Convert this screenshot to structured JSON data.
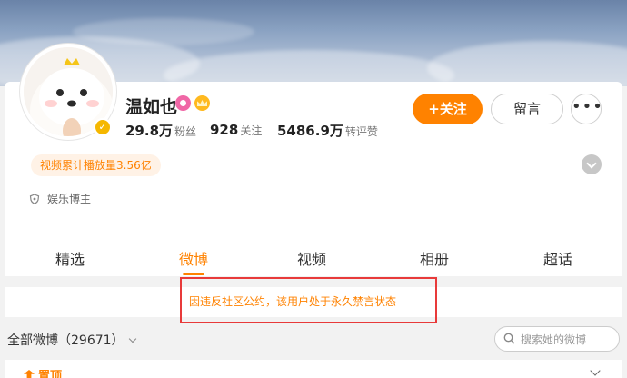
{
  "profile": {
    "name": "温如也",
    "stats": [
      {
        "value": "29.8万",
        "label": "粉丝"
      },
      {
        "value": "928",
        "label": "关注"
      },
      {
        "value": "5486.9万",
        "label": "转评赞"
      }
    ],
    "views_tag": "视频累计播放量3.56亿",
    "category": "娱乐博主"
  },
  "actions": {
    "follow_label": "+关注",
    "message_label": "留言",
    "more_label": "•••"
  },
  "tabs": [
    {
      "label": "精选",
      "active": false
    },
    {
      "label": "微博",
      "active": true
    },
    {
      "label": "视频",
      "active": false
    },
    {
      "label": "相册",
      "active": false
    },
    {
      "label": "超话",
      "active": false
    }
  ],
  "notice": "因违反社区公约，该用户处于永久禁言状态",
  "posts": {
    "all_label": "全部微博（29671）",
    "search_placeholder": "搜索她的微博",
    "pinned_label": "置顶"
  },
  "colors": {
    "accent": "#ff8200",
    "notice_border": "#e83a3a",
    "verified": "#f5b700"
  },
  "icons": [
    "vip-icon",
    "crown-icon",
    "verified-icon",
    "expand-icon",
    "category-shield-icon",
    "chevron-down-icon",
    "search-icon",
    "pin-icon"
  ]
}
